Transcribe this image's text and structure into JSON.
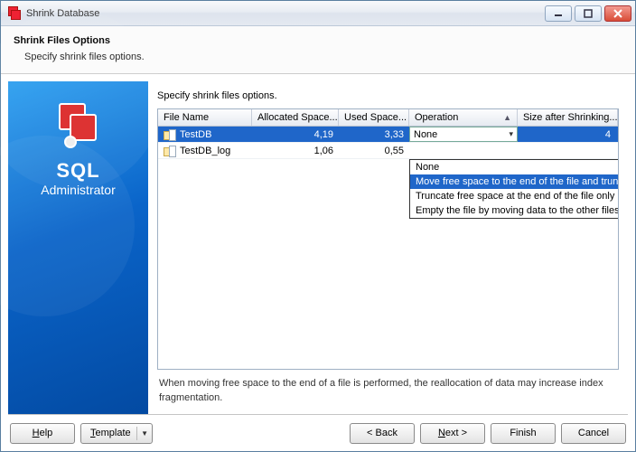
{
  "window": {
    "title": "Shrink Database"
  },
  "header": {
    "title": "Shrink Files Options",
    "subtitle": "Specify shrink files options."
  },
  "sidebar": {
    "brand_line1": "SQL",
    "brand_line2": "Administrator"
  },
  "main": {
    "label": "Specify shrink files options.",
    "columns": {
      "file_name": "File Name",
      "allocated": "Allocated Space...",
      "used": "Used Space...",
      "operation": "Operation",
      "size_after": "Size after Shrinking..."
    },
    "rows": [
      {
        "file_name": "TestDB",
        "allocated": "4,19",
        "used": "3,33",
        "operation": "None",
        "size_after": "4",
        "selected": true
      },
      {
        "file_name": "TestDB_log",
        "allocated": "1,06",
        "used": "0,55",
        "operation": "",
        "size_after": "",
        "selected": false
      }
    ],
    "dropdown_options": [
      "None",
      "Move free space to the end of the file and truncate",
      "Truncate free space at the end of the file only",
      "Empty the file by moving data to the other files"
    ],
    "dropdown_highlight_index": 1,
    "hint": "When moving free space to the end of a file is performed, the reallocation of data may increase index fragmentation."
  },
  "footer": {
    "help": "Help",
    "template": "Template",
    "back": "< Back",
    "next": "Next >",
    "finish": "Finish",
    "cancel": "Cancel"
  }
}
